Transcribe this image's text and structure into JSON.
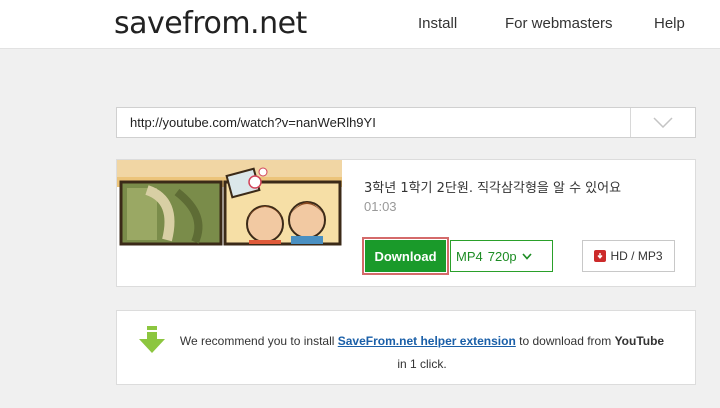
{
  "header": {
    "logo": "savefrom.net",
    "nav": [
      {
        "label": "Install"
      },
      {
        "label": "For webmasters"
      },
      {
        "label": "Help"
      }
    ]
  },
  "search": {
    "url_value": "http://youtube.com/watch?v=nanWeRlh9YI"
  },
  "result": {
    "title": "3학년 1학기 2단원. 직각삼각형을 알 수 있어요",
    "duration": "01:03",
    "download_label": "Download",
    "format_label": "MP4",
    "quality_label": "720p",
    "hd_label": "HD / MP3"
  },
  "recommend": {
    "before": "We recommend you to install",
    "link": "SaveFrom.net helper extension",
    "middle": "to download from",
    "site": "YouTube",
    "after": "in 1 click."
  },
  "colors": {
    "download_green": "#1a9a2a",
    "format_green": "#1d8c24",
    "link_blue": "#1a5fa8",
    "highlight_border": "#d46a6a"
  }
}
